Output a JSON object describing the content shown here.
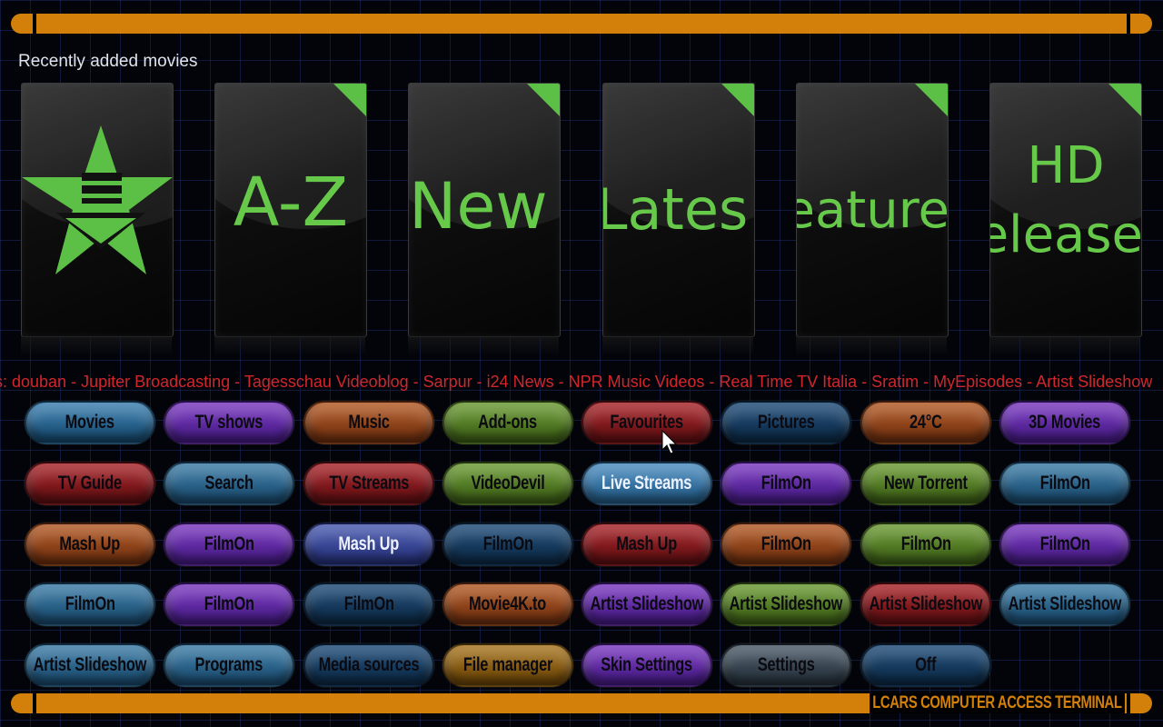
{
  "footer": {
    "terminal_label": "LCARS COMPUTER ACCESS TERMINAL"
  },
  "section": {
    "title": "Recently added movies"
  },
  "cards": [
    {
      "label": "",
      "icon": "star-download-icon"
    },
    {
      "label": "A-Z"
    },
    {
      "label": "New"
    },
    {
      "label": "Lates"
    },
    {
      "label": "eature"
    },
    {
      "label_line1": "HD",
      "label_line2": "elease"
    }
  ],
  "ticker": {
    "text": "s: douban - Jupiter Broadcasting - Tagesschau Videoblog - Sarpur - i24 News - NPR Music Videos - Real Time TV Italia - Sratim - MyEpisodes - Artist Slideshow"
  },
  "menu": {
    "row1": [
      "Movies",
      "TV shows",
      "Music",
      "Add-ons",
      "Favourites",
      "Pictures",
      "24°C",
      "3D Movies"
    ],
    "row2": [
      "TV Guide",
      "Search",
      "TV Streams",
      "VideoDevil",
      "Live Streams",
      "FilmOn",
      "New Torrent",
      "FilmOn"
    ],
    "row3": [
      "Mash Up",
      "FilmOn",
      "Mash Up",
      "FilmOn",
      "Mash Up",
      "FilmOn",
      "FilmOn",
      "FilmOn"
    ],
    "row4": [
      "FilmOn",
      "FilmOn",
      "FilmOn",
      "Movie4K.to",
      "Artist Slideshow",
      "Artist Slideshow",
      "Artist Slideshow",
      "Artist Slideshow"
    ],
    "row5": [
      "Artist Slideshow",
      "Programs",
      "Media sources",
      "File manager",
      "Skin Settings",
      "Settings",
      "Off"
    ]
  },
  "colors": {
    "frame_orange": "#d3800a",
    "card_green": "#66c94a",
    "ticker_red": "#d2262b"
  }
}
